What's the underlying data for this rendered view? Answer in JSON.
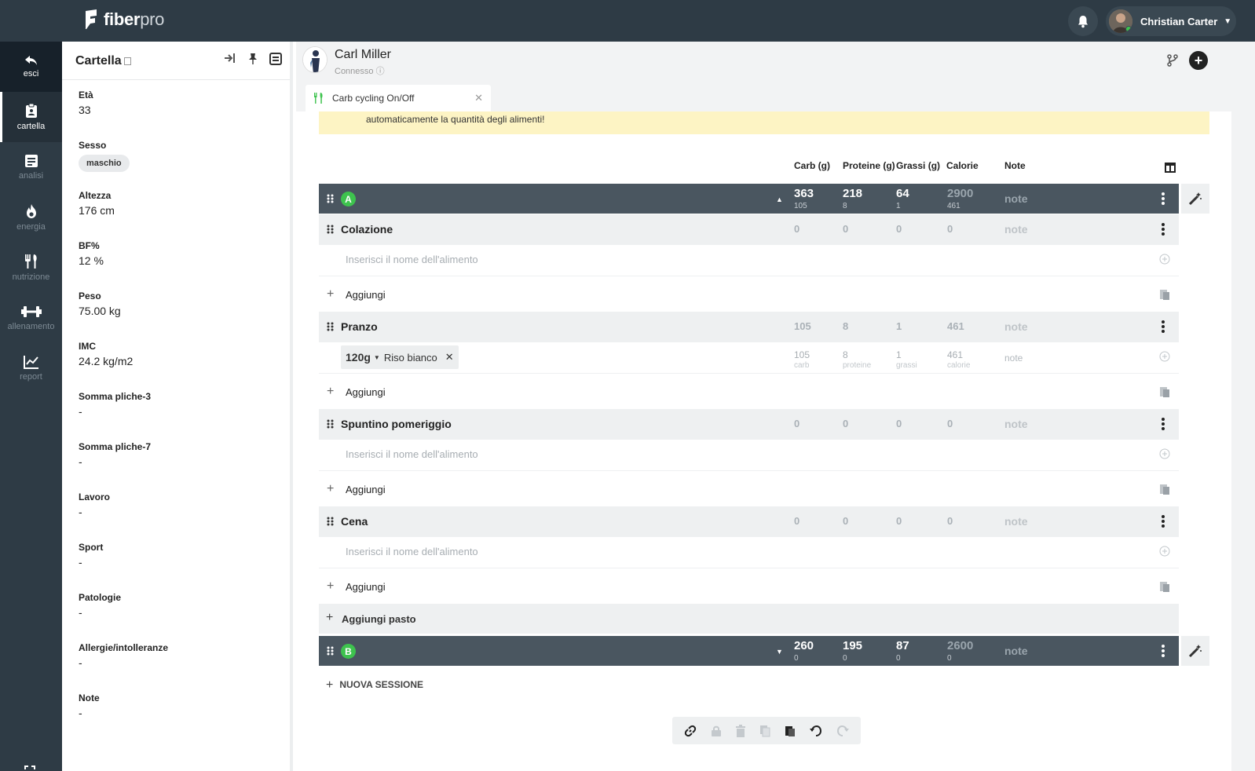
{
  "app": {
    "logo_main": "fiber",
    "logo_sub": "pro"
  },
  "user": {
    "name": "Christian Carter"
  },
  "nav": [
    {
      "key": "esci",
      "label": "esci",
      "icon": "back-arrow-icon"
    },
    {
      "key": "cartella",
      "label": "cartella",
      "icon": "clipboard-icon"
    },
    {
      "key": "analisi",
      "label": "analisi",
      "icon": "document-icon"
    },
    {
      "key": "energia",
      "label": "energia",
      "icon": "flame-icon"
    },
    {
      "key": "nutrizione",
      "label": "nutrizione",
      "icon": "cutlery-icon"
    },
    {
      "key": "allenamento",
      "label": "allenamento",
      "icon": "dumbbell-icon"
    },
    {
      "key": "report",
      "label": "report",
      "icon": "chart-icon"
    }
  ],
  "panel": {
    "title": "Cartella",
    "fields": [
      {
        "label": "Età",
        "value": "33"
      },
      {
        "label": "Sesso",
        "value": "maschio"
      },
      {
        "label": "Altezza",
        "value": "176 cm"
      },
      {
        "label": "BF%",
        "value": "12 %"
      },
      {
        "label": "Peso",
        "value": "75.00 kg"
      },
      {
        "label": "IMC",
        "value": "24.2 kg/m2"
      },
      {
        "label": "Somma pliche-3",
        "value": "-"
      },
      {
        "label": "Somma pliche-7",
        "value": "-"
      },
      {
        "label": "Lavoro",
        "value": "-"
      },
      {
        "label": "Sport",
        "value": "-"
      },
      {
        "label": "Patologie",
        "value": "-"
      },
      {
        "label": "Allergie/intolleranze",
        "value": "-"
      },
      {
        "label": "Note",
        "value": "-"
      }
    ]
  },
  "patient": {
    "name": "Carl Miller",
    "status": "Connesso"
  },
  "tab": {
    "label": "Carb cycling On/Off"
  },
  "notice": "automaticamente la quantità degli alimenti!",
  "columns": {
    "carb": "Carb (g)",
    "protein": "Proteine (g)",
    "fat": "Grassi (g)",
    "calories": "Calorie",
    "note": "Note"
  },
  "sessions": [
    {
      "badge": "A",
      "carb": "363",
      "carb_sub": "105",
      "protein": "218",
      "protein_sub": "8",
      "fat": "64",
      "fat_sub": "1",
      "cal": "2900",
      "cal_sub": "461",
      "note": "note"
    },
    {
      "badge": "B",
      "carb": "260",
      "carb_sub": "0",
      "protein": "195",
      "protein_sub": "0",
      "fat": "87",
      "fat_sub": "0",
      "cal": "2600",
      "cal_sub": "0",
      "note": "note"
    }
  ],
  "meals": [
    {
      "name": "Colazione",
      "carb": "0",
      "protein": "0",
      "fat": "0",
      "cal": "0",
      "note": "note"
    },
    {
      "name": "Pranzo",
      "carb": "105",
      "protein": "8",
      "fat": "1",
      "cal": "461",
      "note": "note"
    },
    {
      "name": "Spuntino pomeriggio",
      "carb": "0",
      "protein": "0",
      "fat": "0",
      "cal": "0",
      "note": "note"
    },
    {
      "name": "Cena",
      "carb": "0",
      "protein": "0",
      "fat": "0",
      "cal": "0",
      "note": "note"
    }
  ],
  "food_placeholder": "Inserisci il nome dell'alimento",
  "food_item": {
    "qty": "120g",
    "name": "Riso bianco",
    "carb": "105",
    "carb_l": "carb",
    "protein": "8",
    "protein_l": "proteine",
    "fat": "1",
    "fat_l": "grassi",
    "cal": "461",
    "cal_l": "calorie",
    "note": "note"
  },
  "labels": {
    "add": "Aggiungi",
    "add_meal": "Aggiungi pasto",
    "new_session": "NUOVA SESSIONE"
  }
}
